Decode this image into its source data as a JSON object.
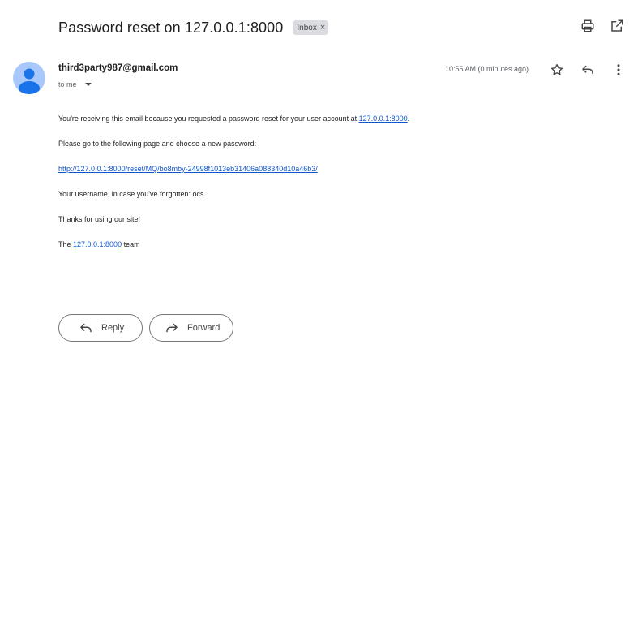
{
  "email": {
    "subject": "Password reset on 127.0.0.1:8000",
    "label": "Inbox",
    "label_remove": "×",
    "sender": "third3party987@gmail.com",
    "recipient_line": "to me",
    "timestamp": "10:55 AM (0 minutes ago)"
  },
  "body": {
    "line1_text": "You're receiving this email because you requested a password reset for your user account at ",
    "line1_link": "127.0.0.1:8000",
    "line1_end": ".",
    "line2": "Please go to the following page and choose a new password:",
    "reset_link": "http://127.0.0.1:8000/reset/MQ/bo8mby-24998f1013eb31406a088340d10a46b3/",
    "line4": "Your username, in case you've forgotten: ocs",
    "line5": "Thanks for using our site!",
    "sign_pre": "The ",
    "sign_link": "127.0.0.1:8000",
    "sign_post": " team"
  },
  "actions": {
    "reply_label": "Reply",
    "forward_label": "Forward"
  },
  "icons": {
    "print": "printer-icon",
    "popout": "open-in-new-window-icon",
    "star": "star-icon",
    "reply": "reply-icon",
    "more": "more-vertical-icon",
    "forward": "forward-icon"
  },
  "colors": {
    "avatar_bg": "#a8c7fa",
    "avatar_fg": "#1a73e8",
    "link": "#1155cc",
    "chip_bg": "#dadce0"
  }
}
